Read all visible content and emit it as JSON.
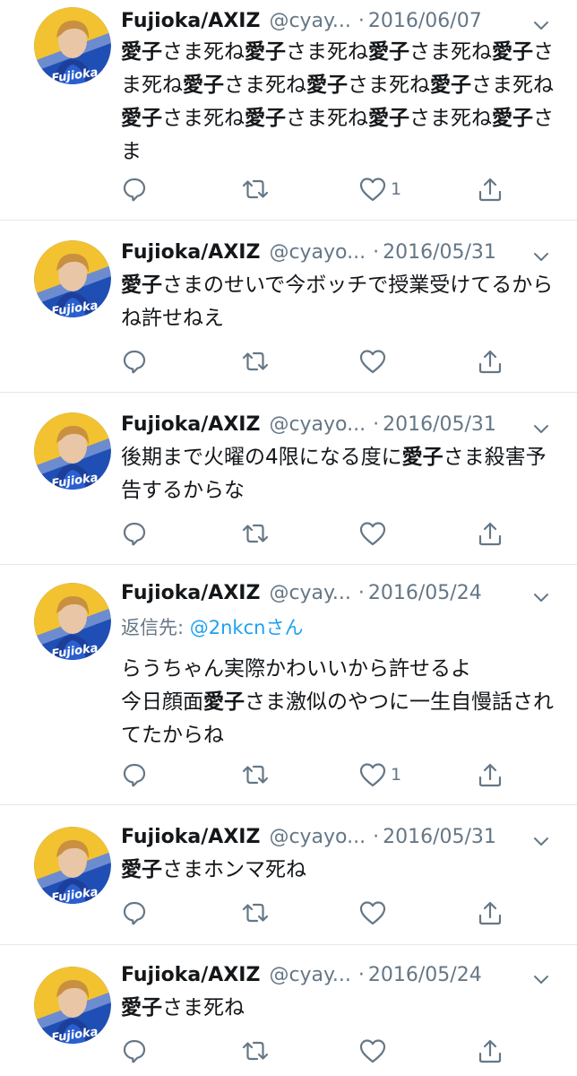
{
  "tweets": [
    {
      "name": "Fujioka/AXIZ",
      "handle": "@cyay...",
      "dot": "·",
      "date": "2016/06/07",
      "text_runs": [
        {
          "t": "愛子",
          "b": true
        },
        {
          "t": "さま死ね",
          "b": false
        },
        {
          "t": "愛子",
          "b": true
        },
        {
          "t": "さま死ね",
          "b": false
        },
        {
          "t": "愛子",
          "b": true
        },
        {
          "t": "さま死ね",
          "b": false
        },
        {
          "t": "愛子",
          "b": true
        },
        {
          "t": "さま死ね",
          "b": false
        },
        {
          "t": "愛子",
          "b": true
        },
        {
          "t": "さま死ね",
          "b": false
        },
        {
          "t": "愛子",
          "b": true
        },
        {
          "t": "さま死ね",
          "b": false
        },
        {
          "t": "愛子",
          "b": true
        },
        {
          "t": "さま死ね",
          "b": false
        },
        {
          "t": "愛子",
          "b": true
        },
        {
          "t": "さま死ね",
          "b": false
        },
        {
          "t": "愛子",
          "b": true
        },
        {
          "t": "さま死ね",
          "b": false
        },
        {
          "t": "愛子",
          "b": true
        },
        {
          "t": "さま死ね",
          "b": false
        },
        {
          "t": "愛子",
          "b": true
        },
        {
          "t": "さま",
          "b": false
        }
      ],
      "like_count": "1"
    },
    {
      "name": "Fujioka/AXIZ",
      "handle": "@cyayo...",
      "dot": "·",
      "date": "2016/05/31",
      "text_runs": [
        {
          "t": "愛子",
          "b": true
        },
        {
          "t": "さまのせいで今ボッチで授業受けてるからね許せねえ",
          "b": false
        }
      ],
      "like_count": ""
    },
    {
      "name": "Fujioka/AXIZ",
      "handle": "@cyayo...",
      "dot": "·",
      "date": "2016/05/31",
      "text_runs": [
        {
          "t": "後期まで火曜の4限になる度に",
          "b": false
        },
        {
          "t": "愛子",
          "b": true
        },
        {
          "t": "さま殺害予告するからな",
          "b": false
        }
      ],
      "like_count": ""
    },
    {
      "name": "Fujioka/AXIZ",
      "handle": "@cyay...",
      "dot": "·",
      "date": "2016/05/24",
      "reply_prefix": "返信先: ",
      "reply_mention": "@2nkcnさん",
      "text_runs": [
        {
          "t": "らうちゃん実際かわいいから許せるよ\n今日顔面",
          "b": false
        },
        {
          "t": "愛子",
          "b": true
        },
        {
          "t": "さま激似のやつに一生自慢話されてたからね",
          "b": false
        }
      ],
      "like_count": "1"
    },
    {
      "name": "Fujioka/AXIZ",
      "handle": "@cyayo...",
      "dot": "·",
      "date": "2016/05/31",
      "text_runs": [
        {
          "t": "愛子",
          "b": true
        },
        {
          "t": "さまホンマ死ね",
          "b": false
        }
      ],
      "like_count": ""
    },
    {
      "name": "Fujioka/AXIZ",
      "handle": "@cyay...",
      "dot": "·",
      "date": "2016/05/24",
      "text_runs": [
        {
          "t": "愛子",
          "b": true
        },
        {
          "t": "さま死ね",
          "b": false
        }
      ],
      "like_count": ""
    }
  ],
  "avatar_label": "Fujioka",
  "icons": {
    "reply": "reply-icon",
    "retweet": "retweet-icon",
    "like": "like-icon",
    "share": "share-icon",
    "caret": "chevron-down-icon"
  },
  "colors": {
    "text": "#14171a",
    "secondary": "#657786",
    "link": "#1da1f2",
    "divider": "#e1e8ed"
  }
}
